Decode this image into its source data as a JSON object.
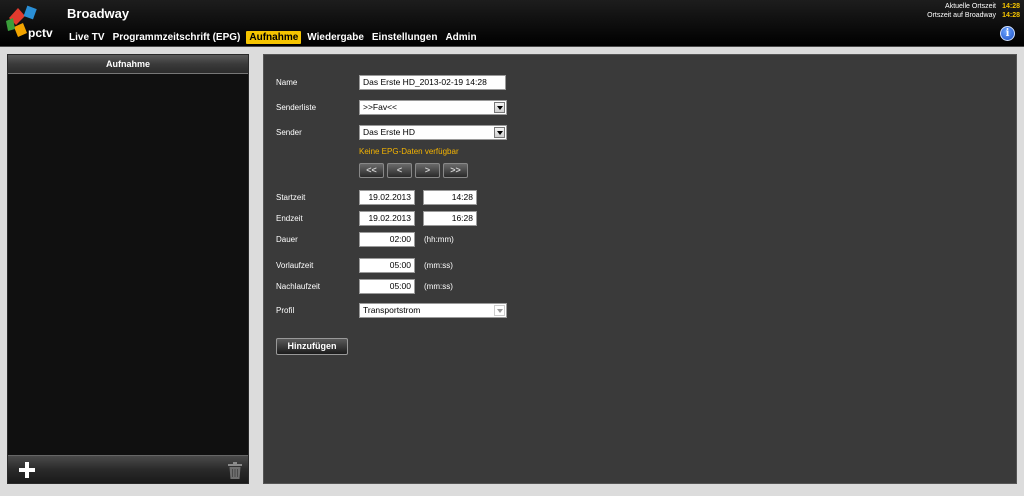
{
  "header": {
    "app_title": "Broadway",
    "nav": [
      {
        "label": "Live TV"
      },
      {
        "label": "Programmzeitschrift (EPG)"
      },
      {
        "label": "Aufnahme"
      },
      {
        "label": "Wiedergabe"
      },
      {
        "label": "Einstellungen"
      },
      {
        "label": "Admin"
      }
    ],
    "active_nav": "Aufnahme",
    "clock": {
      "local_label": "Aktuelle Ortszeit",
      "local_time": "14:28",
      "broadway_label": "Ortszeit auf Broadway",
      "broadway_time": "14:28"
    },
    "info_icon": "info-icon",
    "logo_text": "pctv"
  },
  "left_panel": {
    "title": "Aufnahme",
    "footer_icons": [
      "plus-icon",
      "trash-icon"
    ]
  },
  "form": {
    "name": {
      "label": "Name",
      "value": "Das Erste HD_2013-02-19 14:28"
    },
    "channel_list": {
      "label": "Senderliste",
      "value": ">>Fav<<"
    },
    "channel": {
      "label": "Sender",
      "value": "Das Erste HD"
    },
    "epg_message": "Keine EPG-Daten verfügbar",
    "epg_nav": [
      "<<",
      "<",
      ">",
      ">>"
    ],
    "start": {
      "label": "Startzeit",
      "date": "19.02.2013",
      "time": "14:28"
    },
    "end": {
      "label": "Endzeit",
      "date": "19.02.2013",
      "time": "16:28"
    },
    "duration": {
      "label": "Dauer",
      "value": "02:00",
      "unit": "(hh:mm)"
    },
    "pre_roll": {
      "label": "Vorlaufzeit",
      "value": "05:00",
      "unit": "(mm:ss)"
    },
    "post_roll": {
      "label": "Nachlaufzeit",
      "value": "05:00",
      "unit": "(mm:ss)"
    },
    "profile": {
      "label": "Profil",
      "value": "Transportstrom"
    },
    "submit_label": "Hinzufügen"
  },
  "colors": {
    "accent": "#f5c400",
    "epg_warning": "#f5b400",
    "panel_bg": "#3a3a3a",
    "list_bg": "#101010"
  }
}
